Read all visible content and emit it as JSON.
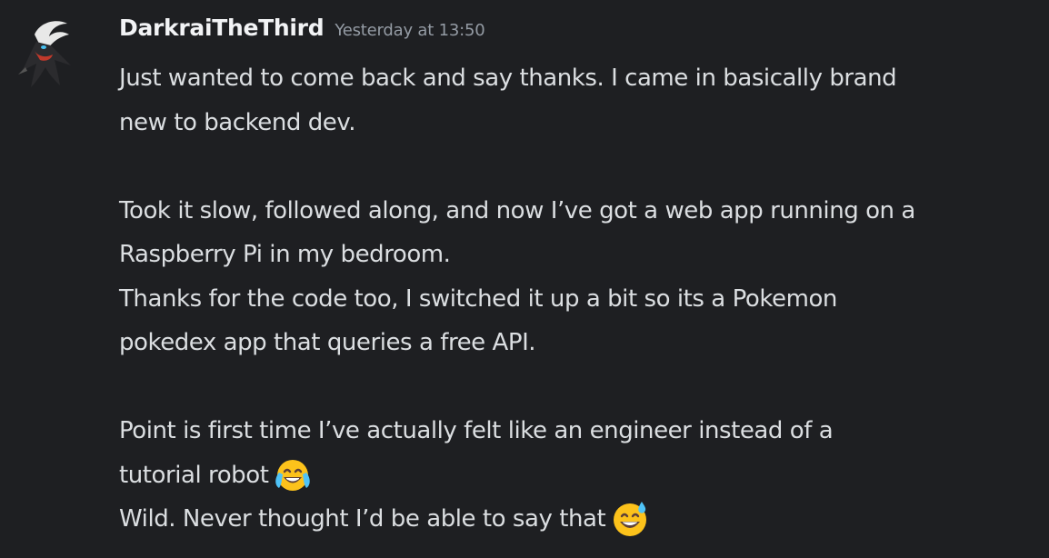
{
  "message": {
    "username": "DarkraiTheThird",
    "timestamp": "Yesterday at 13:50",
    "lines": [
      "Just wanted to come back and say thanks. I came in basically brand",
      "new to backend dev.",
      "",
      "Took it slow, followed along, and now I’ve got a web app running on a",
      "Raspberry Pi in my bedroom.",
      "Thanks for the code too, I switched it up a bit so its a Pokemon",
      "pokedex app that queries a free API.",
      "",
      "Point is first time I’ve actually felt like an engineer instead of a",
      "tutorial robot",
      "Wild. Never thought I’d be able to say that"
    ],
    "emojis": {
      "joy": "face-with-tears-of-joy-icon",
      "sweat_smile": "grinning-face-with-sweat-icon"
    },
    "avatar_icon": "darkrai-avatar-icon"
  },
  "colors": {
    "background": "#1e1f22",
    "username": "#f2f3f5",
    "timestamp": "#949ba4",
    "text": "#dbdee1"
  }
}
